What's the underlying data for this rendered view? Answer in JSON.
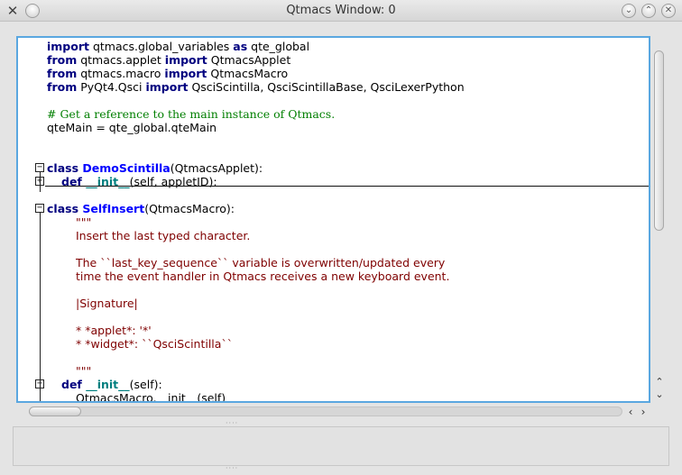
{
  "window": {
    "title": "Qtmacs Window: 0",
    "app_icon": "x-app-icon",
    "title_buttons": [
      "chevron-down-icon",
      "chevron-up-icon",
      "close-icon"
    ]
  },
  "editor": {
    "lines": [
      {
        "segs": [
          [
            "kw",
            "import"
          ],
          [
            "tx",
            " qtmacs.global_variables "
          ],
          [
            "kw",
            "as"
          ],
          [
            "tx",
            " qte_global"
          ]
        ]
      },
      {
        "segs": [
          [
            "kw",
            "from"
          ],
          [
            "tx",
            " qtmacs.applet "
          ],
          [
            "kw",
            "import"
          ],
          [
            "tx",
            " QtmacsApplet"
          ]
        ]
      },
      {
        "segs": [
          [
            "kw",
            "from"
          ],
          [
            "tx",
            " qtmacs.macro "
          ],
          [
            "kw",
            "import"
          ],
          [
            "tx",
            " QtmacsMacro"
          ]
        ]
      },
      {
        "segs": [
          [
            "kw",
            "from"
          ],
          [
            "tx",
            " PyQt4.Qsci "
          ],
          [
            "kw",
            "import"
          ],
          [
            "tx",
            " QsciScintilla, QsciScintillaBase, QsciLexerPython"
          ]
        ]
      },
      {
        "segs": []
      },
      {
        "segs": [
          [
            "cm",
            "# Get a reference to the main instance of Qtmacs."
          ]
        ]
      },
      {
        "segs": [
          [
            "tx",
            "qteMain = qte_global.qteMain"
          ]
        ]
      },
      {
        "segs": []
      },
      {
        "segs": []
      },
      {
        "fold": "minus",
        "segs": [
          [
            "kw",
            "class "
          ],
          [
            "cls",
            "DemoScintilla"
          ],
          [
            "tx",
            "(QtmacsApplet):"
          ]
        ]
      },
      {
        "fold": "plus",
        "indent": 1,
        "segs": [
          [
            "kw",
            "def "
          ],
          [
            "fn",
            "__init__"
          ],
          [
            "tx",
            "(self, appletID):"
          ]
        ]
      },
      {
        "segs": []
      },
      {
        "fold": "minus",
        "segs": [
          [
            "kw",
            "class "
          ],
          [
            "cls",
            "SelfInsert"
          ],
          [
            "tx",
            "(QtmacsMacro):"
          ]
        ]
      },
      {
        "indent": 2,
        "segs": [
          [
            "st",
            "\"\"\""
          ]
        ]
      },
      {
        "indent": 2,
        "segs": [
          [
            "st",
            "Insert the last typed character."
          ]
        ]
      },
      {
        "segs": []
      },
      {
        "indent": 2,
        "segs": [
          [
            "st",
            "The ``last_key_sequence`` variable is overwritten/updated every"
          ]
        ]
      },
      {
        "indent": 2,
        "segs": [
          [
            "st",
            "time the event handler in Qtmacs receives a new keyboard event."
          ]
        ]
      },
      {
        "segs": []
      },
      {
        "indent": 2,
        "segs": [
          [
            "st",
            "|Signature|"
          ]
        ]
      },
      {
        "segs": []
      },
      {
        "indent": 2,
        "segs": [
          [
            "st",
            "* *applet*: '*'"
          ]
        ]
      },
      {
        "indent": 2,
        "segs": [
          [
            "st",
            "* *widget*: ``QsciScintilla``"
          ]
        ]
      },
      {
        "segs": []
      },
      {
        "indent": 2,
        "segs": [
          [
            "st",
            "\"\"\""
          ]
        ]
      },
      {
        "fold": "minus",
        "indent": 1,
        "segs": [
          [
            "kw",
            "def "
          ],
          [
            "fn",
            "__init__"
          ],
          [
            "tx",
            "(self):"
          ]
        ]
      },
      {
        "indent": 3,
        "segs": [
          [
            "tx",
            "QtmacsMacro.__init__(self)"
          ]
        ]
      }
    ]
  },
  "scrollbars": {
    "vertical_up": "chevron-up-icon",
    "vertical_down": "chevron-down-icon",
    "horizontal_left": "chevron-left-icon",
    "horizontal_right": "chevron-right-icon"
  },
  "colors": {
    "keyword": "#00007f",
    "class_name": "#0000ff",
    "function_name": "#007f7f",
    "comment": "#007f00",
    "docstring": "#7f0000",
    "focus_border": "#5aa7e0"
  }
}
